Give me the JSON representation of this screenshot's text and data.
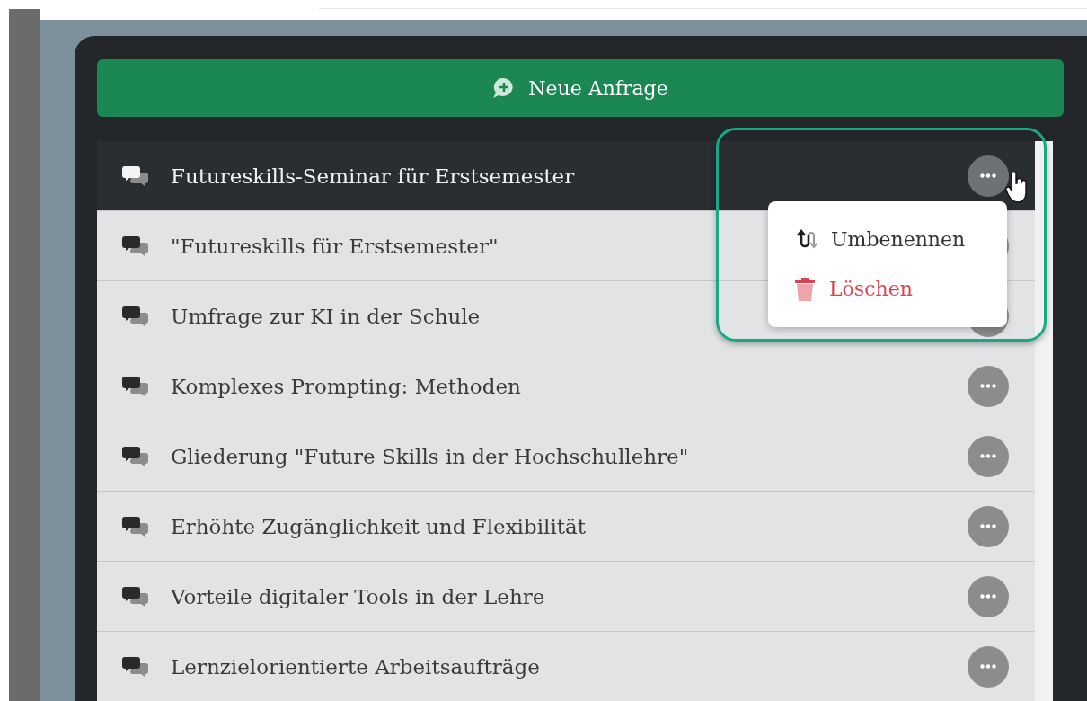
{
  "new_request_button": {
    "label": "Neue Anfrage"
  },
  "conversations": [
    {
      "title": "Futureskills-Seminar für Erstsemester",
      "selected": true
    },
    {
      "title": "\"Futureskills für Erstsemester\"",
      "selected": false
    },
    {
      "title": "Umfrage zur KI in der Schule",
      "selected": false
    },
    {
      "title": "Komplexes Prompting: Methoden",
      "selected": false
    },
    {
      "title": "Gliederung \"Future Skills in der Hochschullehre\"",
      "selected": false
    },
    {
      "title": "Erhöhte Zugänglichkeit und Flexibilität",
      "selected": false
    },
    {
      "title": "Vorteile digitaler Tools in der Lehre",
      "selected": false
    },
    {
      "title": "Lernzielorientierte Arbeitsaufträge",
      "selected": false
    }
  ],
  "context_menu": {
    "items": [
      {
        "kind": "rename",
        "label": "Umbenennen"
      },
      {
        "kind": "delete",
        "label": "Löschen"
      }
    ]
  }
}
